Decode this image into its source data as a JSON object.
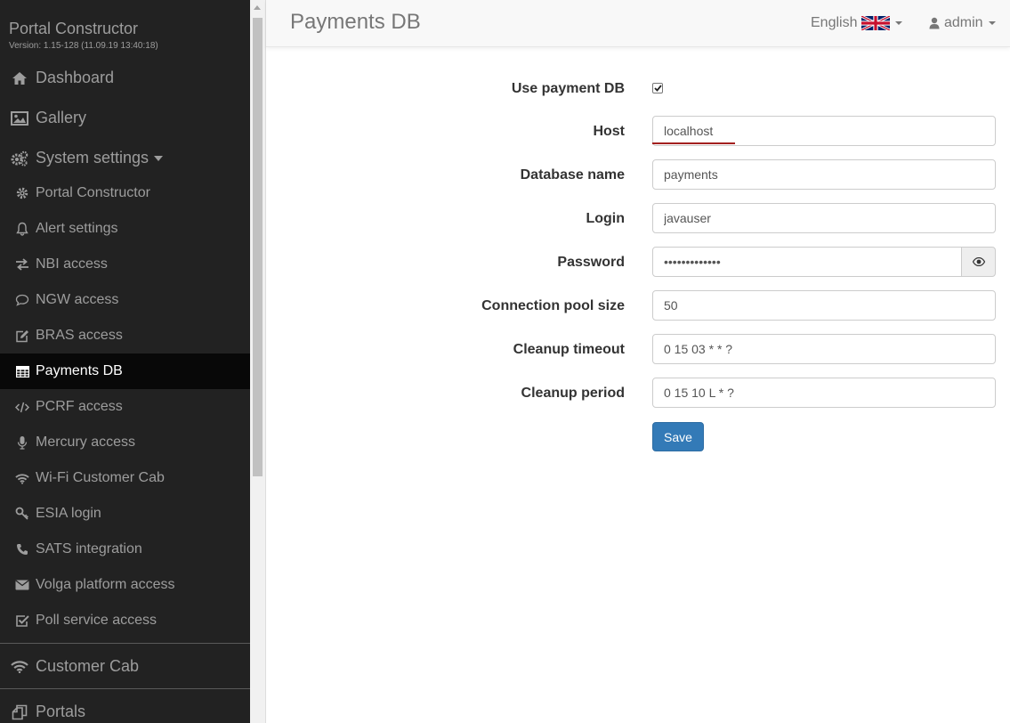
{
  "app": {
    "title": "Portal Constructor",
    "version": "Version: 1.15-128 (11.09.19 13:40:18)"
  },
  "sidebar": {
    "top_items": [
      {
        "label": "Dashboard",
        "icon": "home-icon"
      },
      {
        "label": "Gallery",
        "icon": "picture-icon"
      },
      {
        "label": "System settings",
        "icon": "gears-icon"
      }
    ],
    "sub_items": [
      {
        "label": "Portal Constructor",
        "icon": "gear-icon"
      },
      {
        "label": "Alert settings",
        "icon": "bell-icon"
      },
      {
        "label": "NBI access",
        "icon": "exchange-icon"
      },
      {
        "label": "NGW access",
        "icon": "speech-bubble-icon"
      },
      {
        "label": "BRAS access",
        "icon": "edit-icon"
      },
      {
        "label": "Payments DB",
        "icon": "table-icon",
        "active": true
      },
      {
        "label": "PCRF access",
        "icon": "code-icon"
      },
      {
        "label": "Mercury access",
        "icon": "microphone-icon"
      },
      {
        "label": "Wi-Fi Customer Cab",
        "icon": "wifi-icon"
      },
      {
        "label": "ESIA login",
        "icon": "key-icon"
      },
      {
        "label": "SATS integration",
        "icon": "phone-icon"
      },
      {
        "label": "Volga platform access",
        "icon": "envelope-icon"
      },
      {
        "label": "Poll service access",
        "icon": "check-square-icon"
      }
    ],
    "bottom_items": [
      {
        "label": "Customer Cab",
        "icon": "wifi-icon"
      },
      {
        "label": "Portals",
        "icon": "copy-icon"
      }
    ]
  },
  "header": {
    "page_title": "Payments DB",
    "language": "English",
    "user": "admin"
  },
  "form": {
    "use_payment_db": {
      "label": "Use payment DB",
      "checked": true
    },
    "host": {
      "label": "Host",
      "value": "localhost"
    },
    "database_name": {
      "label": "Database name",
      "value": "payments"
    },
    "login": {
      "label": "Login",
      "value": "javauser"
    },
    "password": {
      "label": "Password",
      "value": "•••••••••••••"
    },
    "pool_size": {
      "label": "Connection pool size",
      "value": "50"
    },
    "cleanup_timeout": {
      "label": "Cleanup timeout",
      "value": "0 15 03 * * ?"
    },
    "cleanup_period": {
      "label": "Cleanup period",
      "value": "0 15 10 L * ?"
    },
    "save_label": "Save"
  },
  "colors": {
    "sidebar_bg": "#222222",
    "sidebar_active_bg": "#080808",
    "primary": "#337ab7",
    "error_underline": "#a3201f"
  }
}
